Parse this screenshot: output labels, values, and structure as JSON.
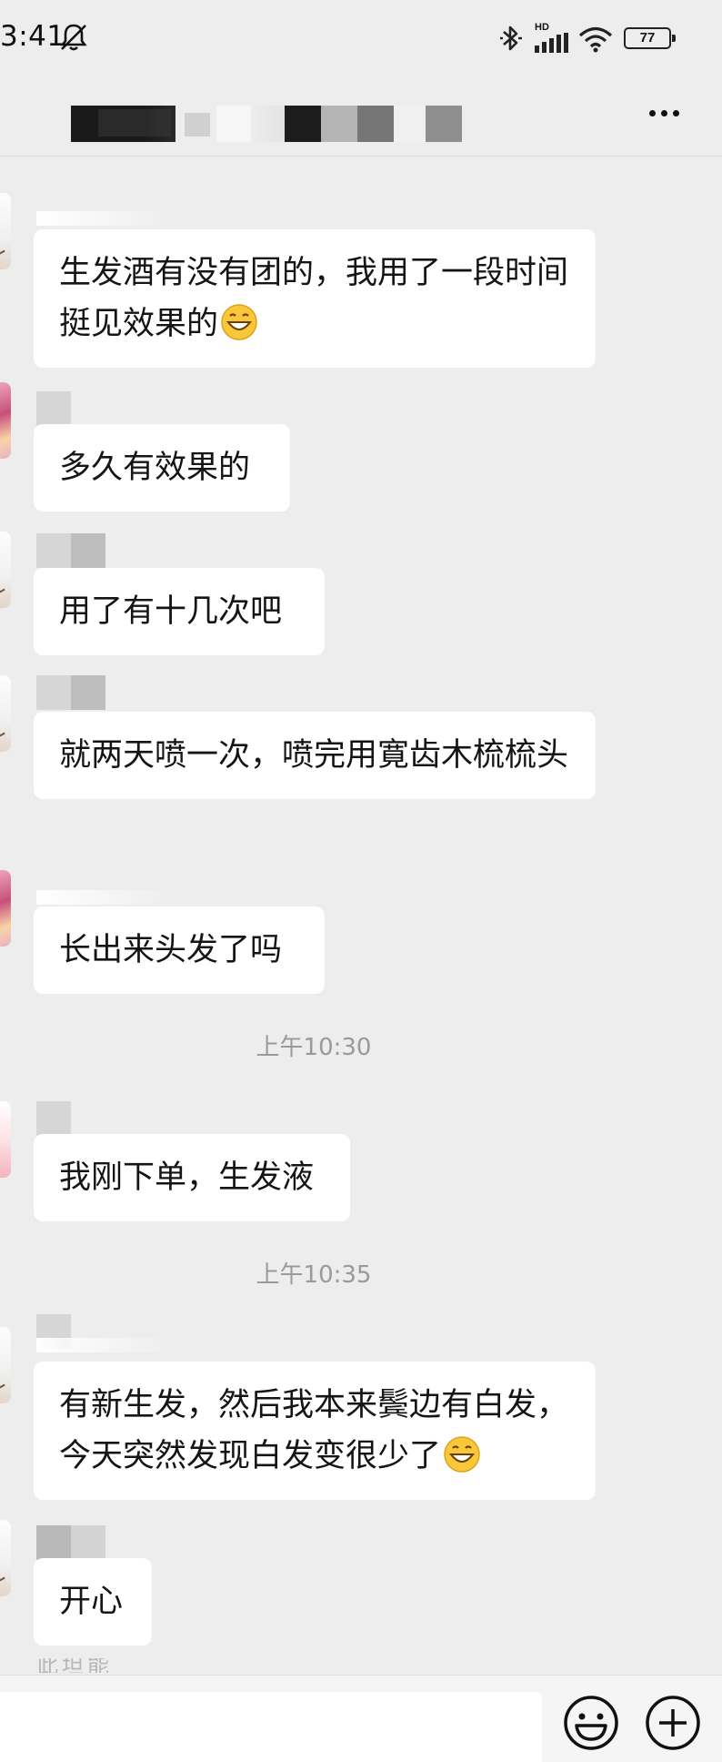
{
  "status_bar": {
    "time": "3:41",
    "network_label": "HD",
    "battery": "77",
    "icons": [
      "mute-icon",
      "bluetooth-icon",
      "signal-icon",
      "wifi-icon",
      "battery-icon"
    ]
  },
  "header": {
    "title_redacted": true,
    "more_icon": "more-icon"
  },
  "messages": [
    {
      "text": "生发酒有没有团的，我用了一段时间挺见效果的",
      "emoji": "grinning-face"
    },
    {
      "text": "多久有效果的"
    },
    {
      "text": "用了有十几次吧"
    },
    {
      "text": "就两天喷一次，喷完用寛齿木梳梳头"
    },
    {
      "text": "长出来头发了吗"
    },
    {
      "text": "我刚下单，生发液"
    },
    {
      "text": "有新生发，然后我本来鬓边有白发，今天突然发现白发变很少了",
      "emoji": "grinning-face"
    },
    {
      "text": "开心"
    }
  ],
  "timestamps": [
    "上午10:30",
    "上午10:35"
  ],
  "partial_name": "此坦能",
  "input_bar": {
    "placeholder": "",
    "emoji_icon": "emoji-icon",
    "plus_icon": "plus-icon"
  },
  "colors": {
    "background": "#ededed",
    "bubble": "#ffffff",
    "timestamp": "#9a9a9a",
    "text": "#151515"
  }
}
